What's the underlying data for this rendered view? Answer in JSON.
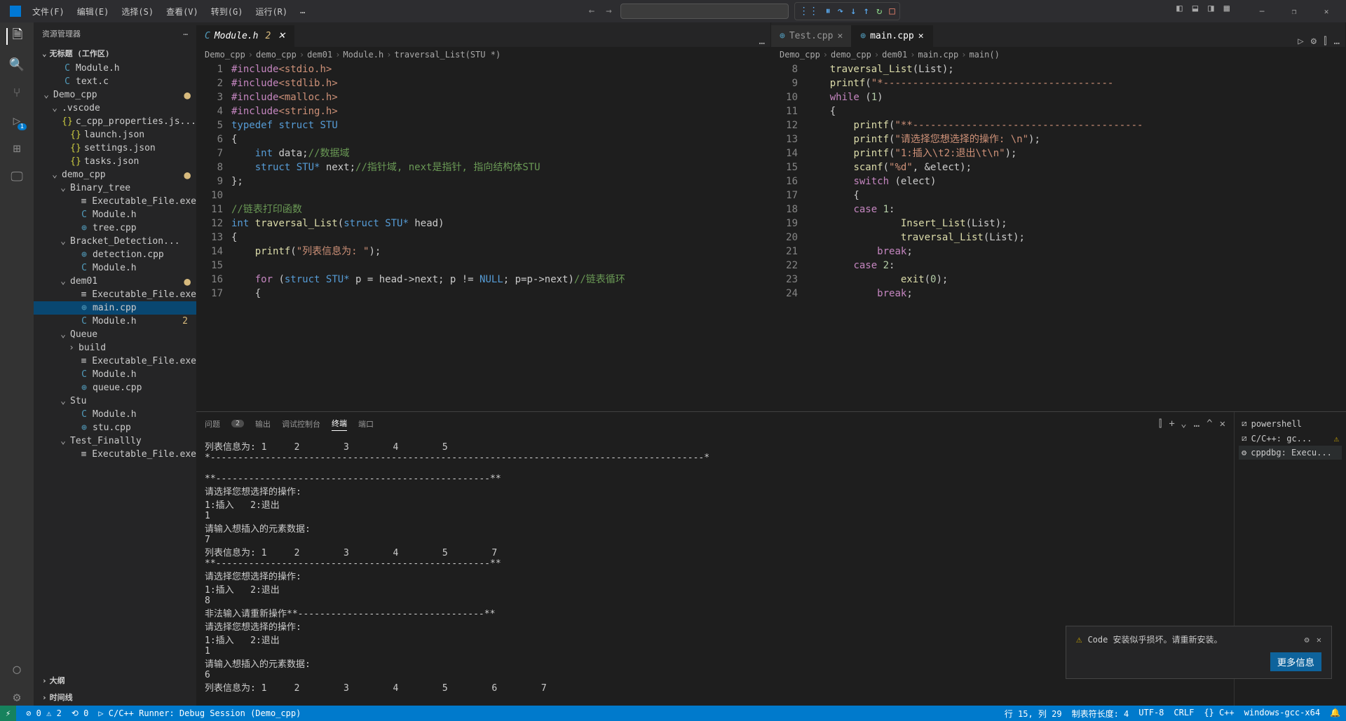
{
  "menu": {
    "file": "文件(F)",
    "edit": "编辑(E)",
    "select": "选择(S)",
    "view": "查看(V)",
    "go": "转到(G)",
    "run": "运行(R)",
    "more": "…"
  },
  "sidebar": {
    "title": "资源管理器",
    "root": "无标题 (工作区)",
    "tree": [
      {
        "ic": "C",
        "cls": "ic-c",
        "label": "Module.h",
        "ind": 1
      },
      {
        "ic": "C",
        "cls": "ic-c",
        "label": "text.c",
        "ind": 1
      },
      {
        "chev": "⌄",
        "label": "Demo_cpp",
        "ind": 0,
        "mod": true
      },
      {
        "chev": "⌄",
        "label": ".vscode",
        "ind": 1
      },
      {
        "ic": "{}",
        "cls": "ic-json",
        "label": "c_cpp_properties.js...",
        "ind": 2
      },
      {
        "ic": "{}",
        "cls": "ic-json",
        "label": "launch.json",
        "ind": 2
      },
      {
        "ic": "{}",
        "cls": "ic-json",
        "label": "settings.json",
        "ind": 2
      },
      {
        "ic": "{}",
        "cls": "ic-json",
        "label": "tasks.json",
        "ind": 2
      },
      {
        "chev": "⌄",
        "label": "demo_cpp",
        "ind": 1,
        "mod": true
      },
      {
        "chev": "⌄",
        "label": "Binary_tree",
        "ind": 2
      },
      {
        "ic": "≡",
        "label": "Executable_File.exe",
        "ind": 3
      },
      {
        "ic": "C",
        "cls": "ic-c",
        "label": "Module.h",
        "ind": 3
      },
      {
        "ic": "⊕",
        "cls": "ic-cpp",
        "label": "tree.cpp",
        "ind": 3
      },
      {
        "chev": "⌄",
        "label": "Bracket_Detection...",
        "ind": 2
      },
      {
        "ic": "⊕",
        "cls": "ic-cpp",
        "label": "detection.cpp",
        "ind": 3
      },
      {
        "ic": "C",
        "cls": "ic-c",
        "label": "Module.h",
        "ind": 3
      },
      {
        "chev": "⌄",
        "label": "dem01",
        "ind": 2,
        "mod": true
      },
      {
        "ic": "≡",
        "label": "Executable_File.exe",
        "ind": 3
      },
      {
        "ic": "⊕",
        "cls": "ic-cpp",
        "label": "main.cpp",
        "ind": 3,
        "selected": true
      },
      {
        "ic": "C",
        "cls": "ic-c",
        "label": "Module.h",
        "ind": 3,
        "badge": "2"
      },
      {
        "chev": "⌄",
        "label": "Queue",
        "ind": 2
      },
      {
        "chev": "›",
        "label": "build",
        "ind": 3
      },
      {
        "ic": "≡",
        "label": "Executable_File.exe",
        "ind": 3
      },
      {
        "ic": "C",
        "cls": "ic-c",
        "label": "Module.h",
        "ind": 3
      },
      {
        "ic": "⊕",
        "cls": "ic-cpp",
        "label": "queue.cpp",
        "ind": 3
      },
      {
        "chev": "⌄",
        "label": "Stu",
        "ind": 2
      },
      {
        "ic": "C",
        "cls": "ic-c",
        "label": "Module.h",
        "ind": 3
      },
      {
        "ic": "⊕",
        "cls": "ic-cpp",
        "label": "stu.cpp",
        "ind": 3
      },
      {
        "chev": "⌄",
        "label": "Test_Finallly",
        "ind": 2
      },
      {
        "ic": "≡",
        "label": "Executable_File.exe",
        "ind": 3
      }
    ],
    "outline": "大纲",
    "timeline": "时间线"
  },
  "editorLeft": {
    "tab": {
      "label": "Module.h",
      "badge": "2"
    },
    "crumbs": [
      "Demo_cpp",
      "demo_cpp",
      "dem01",
      "Module.h",
      "traversal_List(STU *)"
    ],
    "lines": [
      {
        "n": 1,
        "html": "<span class='kw'>#include</span><span class='str'>&lt;stdio.h&gt;</span>"
      },
      {
        "n": 2,
        "html": "<span class='kw'>#include</span><span class='str'>&lt;stdlib.h&gt;</span>"
      },
      {
        "n": 3,
        "html": "<span class='kw'>#include</span><span class='str'>&lt;malloc.h&gt;</span>"
      },
      {
        "n": 4,
        "html": "<span class='kw'>#include</span><span class='str'>&lt;string.h&gt;</span>"
      },
      {
        "n": 5,
        "html": "<span class='type'>typedef</span> <span class='type'>struct</span> <span class='type'>STU</span>"
      },
      {
        "n": 6,
        "html": "{"
      },
      {
        "n": 7,
        "html": "    <span class='type'>int</span> data;<span class='comment'>//数据域</span>"
      },
      {
        "n": 8,
        "html": "    <span class='type'>struct</span> <span class='type'>STU*</span> next;<span class='comment'>//指针域, next是指针, 指向结构体STU</span>"
      },
      {
        "n": 9,
        "html": "};"
      },
      {
        "n": 10,
        "html": ""
      },
      {
        "n": 11,
        "html": "<span class='comment'>//链表打印函数</span>"
      },
      {
        "n": 12,
        "html": "<span class='type'>int</span> <span class='func'>traversal_List</span>(<span class='type'>struct</span> <span class='type'>STU*</span> head)"
      },
      {
        "n": 13,
        "html": "{"
      },
      {
        "n": 14,
        "html": "    <span class='func'>printf</span>(<span class='str'>\"列表信息为: \"</span>);"
      },
      {
        "n": 15,
        "html": ""
      },
      {
        "n": 16,
        "html": "    <span class='kw'>for</span> (<span class='type'>struct</span> <span class='type'>STU*</span> p = head-&gt;next; p != <span class='const-val'>NULL</span>; p=p-&gt;next)<span class='comment'>//链表循环</span>"
      },
      {
        "n": 17,
        "html": "    {"
      }
    ]
  },
  "editorRight": {
    "tabs": [
      {
        "label": "Test.cpp"
      },
      {
        "label": "main.cpp",
        "active": true
      }
    ],
    "crumbs": [
      "Demo_cpp",
      "demo_cpp",
      "dem01",
      "main.cpp",
      "main()"
    ],
    "lines": [
      {
        "n": 8,
        "html": "    <span class='func'>traversal_List</span>(List);"
      },
      {
        "n": 9,
        "html": "    <span class='func'>printf</span>(<span class='str'>\"*---------------------------------------</span>"
      },
      {
        "n": 10,
        "html": "    <span class='kw'>while</span> (<span class='num'>1</span>)"
      },
      {
        "n": 11,
        "html": "    {"
      },
      {
        "n": 12,
        "html": "        <span class='func'>printf</span>(<span class='str'>\"**---------------------------------------</span>"
      },
      {
        "n": 13,
        "html": "        <span class='func'>printf</span>(<span class='str'>\"请选择您想选择的操作: \\n\"</span>);"
      },
      {
        "n": 14,
        "html": "        <span class='func'>printf</span>(<span class='str'>\"1:插入\\t2:退出\\t\\n\"</span>);"
      },
      {
        "n": 15,
        "html": "        <span class='func'>scanf</span>(<span class='str'>\"%d\"</span>, &elect);"
      },
      {
        "n": 16,
        "html": "        <span class='kw'>switch</span> (elect)"
      },
      {
        "n": 17,
        "html": "        {"
      },
      {
        "n": 18,
        "html": "        <span class='kw'>case</span> <span class='num'>1</span>:"
      },
      {
        "n": 19,
        "html": "                <span class='func'>Insert_List</span>(List);"
      },
      {
        "n": 20,
        "html": "                <span class='func'>traversal_List</span>(List);"
      },
      {
        "n": 21,
        "html": "            <span class='kw'>break</span>;"
      },
      {
        "n": 22,
        "html": "        <span class='kw'>case</span> <span class='num'>2</span>:"
      },
      {
        "n": 23,
        "html": "                <span class='func'>exit</span>(<span class='num'>0</span>);"
      },
      {
        "n": 24,
        "html": "            <span class='kw'>break</span>;"
      }
    ]
  },
  "panel": {
    "tabs": {
      "problems": "问题",
      "problemsBadge": "2",
      "output": "输出",
      "debug": "调试控制台",
      "terminal": "终端",
      "ports": "端口"
    },
    "terminal": "列表信息为: 1     2        3        4        5\n*------------------------------------------------------------------------------------------*\n\n**--------------------------------------------------**\n请选择您想选择的操作:\n1:插入   2:退出\n1\n请输入想插入的元素数据:\n7\n列表信息为: 1     2        3        4        5        7\n**--------------------------------------------------**\n请选择您想选择的操作:\n1:插入   2:退出\n8\n非法输入请重新操作**----------------------------------**\n请选择您想选择的操作:\n1:插入   2:退出\n1\n请输入想插入的元素数据:\n6\n列表信息为: 1     2        3        4        5        6        7",
    "terminals": [
      {
        "ic": "⧄",
        "label": "powershell"
      },
      {
        "ic": "⧄",
        "label": "C/C++: gc...",
        "warn": true
      },
      {
        "ic": "⚙",
        "label": "cppdbg: Execu...",
        "selected": true
      }
    ]
  },
  "notification": {
    "text": "Code 安装似乎损坏。请重新安装。",
    "action": "更多信息"
  },
  "status": {
    "errors": "⊘ 0 ⚠ 2",
    "ports": "⟲ 0",
    "debug": "▷ C/C++ Runner: Debug Session (Demo_cpp)",
    "pos": "行 15, 列 29",
    "tab": "制表符长度: 4",
    "enc": "UTF-8",
    "eol": "CRLF",
    "lang": "{} C++",
    "kit": "windows-gcc-x64",
    "bell": "🔔"
  }
}
